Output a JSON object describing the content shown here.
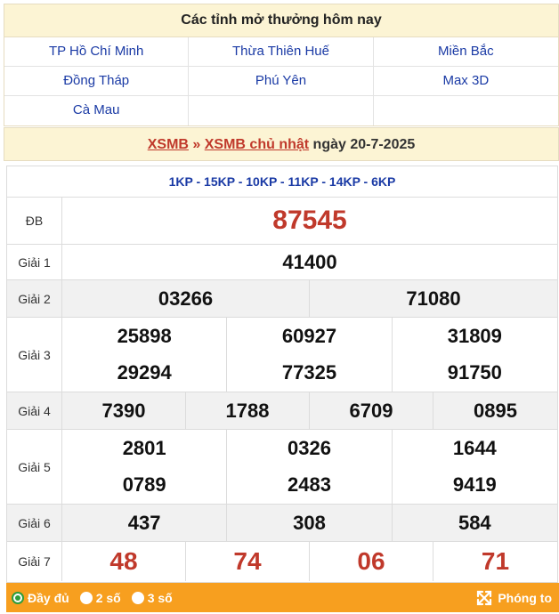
{
  "provinces": {
    "heading": "Các tỉnh mở thưởng hôm nay",
    "rows": [
      [
        "TP Hồ Chí Minh",
        "Thừa Thiên Huế",
        "Miền Bắc"
      ],
      [
        "Đồng Tháp",
        "Phú Yên",
        "Max 3D"
      ],
      [
        "Cà Mau",
        "",
        ""
      ]
    ]
  },
  "title": {
    "link1": "XSMB",
    "sep": " » ",
    "link2": "XSMB chủ nhật",
    "date_text": " ngày 20-7-2025"
  },
  "codes": "1KP - 15KP - 10KP - 11KP - 14KP - 6KP",
  "prizes": {
    "db": {
      "label": "ĐB",
      "numbers": [
        "87545"
      ]
    },
    "g1": {
      "label": "Giải 1",
      "numbers": [
        "41400"
      ]
    },
    "g2": {
      "label": "Giải 2",
      "numbers": [
        "03266",
        "71080"
      ]
    },
    "g3": {
      "label": "Giải 3",
      "numbers": [
        "25898",
        "60927",
        "31809",
        "29294",
        "77325",
        "91750"
      ]
    },
    "g4": {
      "label": "Giải 4",
      "numbers": [
        "7390",
        "1788",
        "6709",
        "0895"
      ]
    },
    "g5": {
      "label": "Giải 5",
      "numbers": [
        "2801",
        "0326",
        "1644",
        "0789",
        "2483",
        "9419"
      ]
    },
    "g6": {
      "label": "Giải 6",
      "numbers": [
        "437",
        "308",
        "584"
      ]
    },
    "g7": {
      "label": "Giải 7",
      "numbers": [
        "48",
        "74",
        "06",
        "71"
      ]
    }
  },
  "bottom_bar": {
    "options": [
      "Đầy đủ",
      "2 số",
      "3 số"
    ],
    "selected": "Đầy đủ",
    "zoom_label": "Phóng to",
    "zoom_icon": "expand-arrows-icon"
  },
  "colors": {
    "accent_red": "#c0392b",
    "link_blue": "#1a3aa5",
    "bar_orange": "#f79f1f",
    "radio_green": "#2e9c3c"
  }
}
